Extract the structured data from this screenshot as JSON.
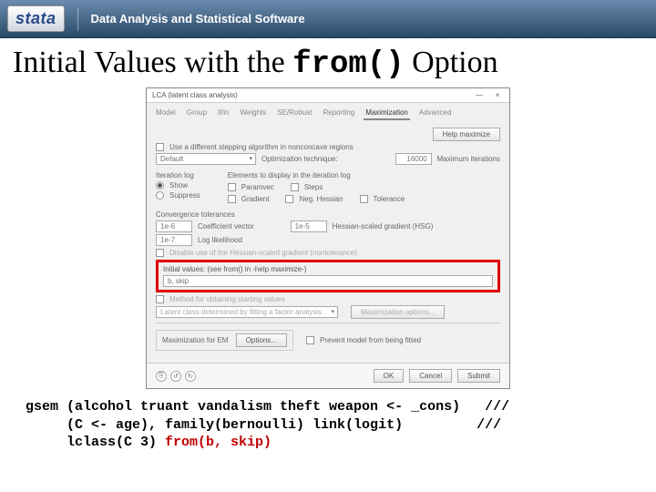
{
  "banner": {
    "logo": "stata",
    "tagline": "Data Analysis and Statistical Software"
  },
  "title": {
    "pre": "Initial Values with the ",
    "mono": "from()",
    "post": " Option"
  },
  "dialog": {
    "title": "LCA (latent class analysis)",
    "min": "—",
    "close": "×",
    "tabs": [
      "Model",
      "Group",
      "if/in",
      "Weights",
      "SE/Robust",
      "Reporting",
      "Maximization",
      "Advanced"
    ],
    "help_btn": "Help maximize",
    "diffstep": "Use a different stepping algorithm in nonconcave regions",
    "opt_label": "Optimization technique:",
    "opt_value": "Default",
    "maxiter_value": "16000",
    "maxiter_label": "Maximum iterations",
    "iterlog_label": "Iteration log",
    "show": "Show",
    "suppress": "Suppress",
    "disp_label": "Elements to display in the iteration log",
    "paramvec": "Paramvec",
    "steps": "Steps",
    "gradient": "Gradient",
    "neghess": "Neg. Hessian",
    "tolerance": "Tolerance",
    "convtol_label": "Convergence tolerances",
    "tol1": "1e-6",
    "coef": "Coefficient vector",
    "tol2": "1e-5",
    "hsg": "Hessian-scaled gradient (HSG)",
    "tol3": "1e-7",
    "loglik": "Log likelihood",
    "disable_hsg": "Disable use of the Hessian-scaled gradient (nontolerance)",
    "init_label": "Initial values: (see from() in -help maximize-)",
    "init_value": "b, skip",
    "startmethod": "Method for obtaining starting values",
    "latent_default": "Latent class determined by fitting a factor analysis",
    "maxopts": "Maximization options...",
    "em_label": "Maximization for EM",
    "em_btn": "Options...",
    "prevent": "Prevent model from being fitted",
    "ok": "OK",
    "cancel": "Cancel",
    "submit": "Submit",
    "copy": "⎘",
    "undo": "↺",
    "redo": "↻"
  },
  "code": {
    "l1a": "gsem (alcohol truant vandalism theft weapon <- _cons)",
    "l1b": "   ///",
    "l2a": "     (C <- age), family(bernoulli) link(logit)",
    "l2b": "         ///",
    "l3a": "     lclass(C 3) ",
    "l3hl": "from(b, skip)"
  }
}
